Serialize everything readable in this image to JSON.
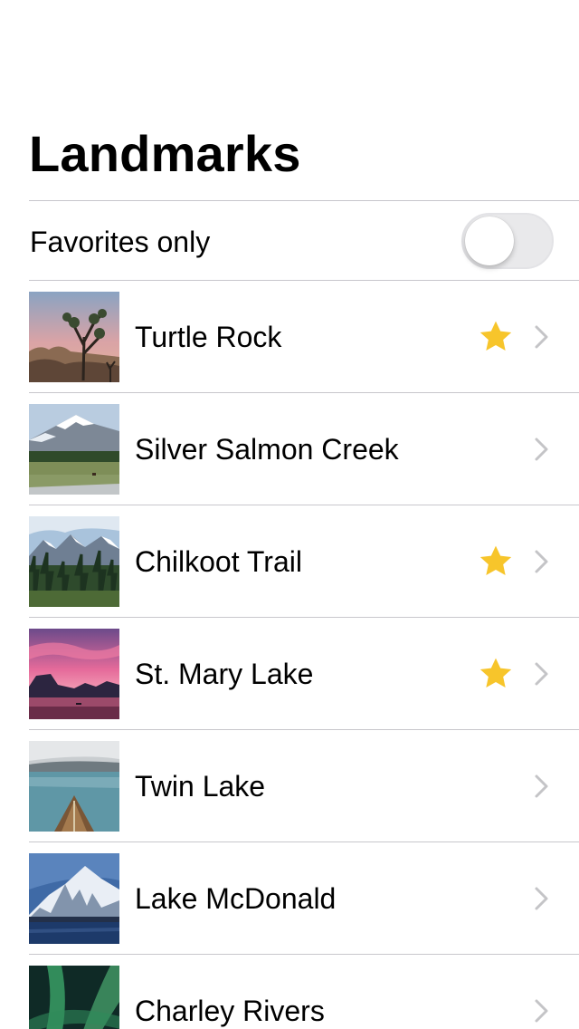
{
  "nav": {
    "title": "Landmarks"
  },
  "filter": {
    "label": "Favorites only",
    "is_on": false
  },
  "landmarks": [
    {
      "name": "Turtle Rock",
      "favorite": true,
      "thumbnail": "joshua-tree-desert-image"
    },
    {
      "name": "Silver Salmon Creek",
      "favorite": false,
      "thumbnail": "snowy-mountain-meadow-image"
    },
    {
      "name": "Chilkoot Trail",
      "favorite": true,
      "thumbnail": "mountain-forest-image"
    },
    {
      "name": "St. Mary Lake",
      "favorite": true,
      "thumbnail": "pink-sunset-lake-image"
    },
    {
      "name": "Twin Lake",
      "favorite": false,
      "thumbnail": "canoe-on-lake-image"
    },
    {
      "name": "Lake McDonald",
      "favorite": false,
      "thumbnail": "snowy-peak-lake-image"
    },
    {
      "name": "Charley Rivers",
      "favorite": false,
      "thumbnail": "aurora-forest-image"
    }
  ],
  "colors": {
    "star": "#f7c52b",
    "chevron": "#c4c4c7",
    "separator": "#c8c7cc",
    "switch_off_track": "#e9e9eb"
  },
  "icons": {
    "favorite": "star-icon",
    "disclosure": "chevron-right-icon"
  }
}
